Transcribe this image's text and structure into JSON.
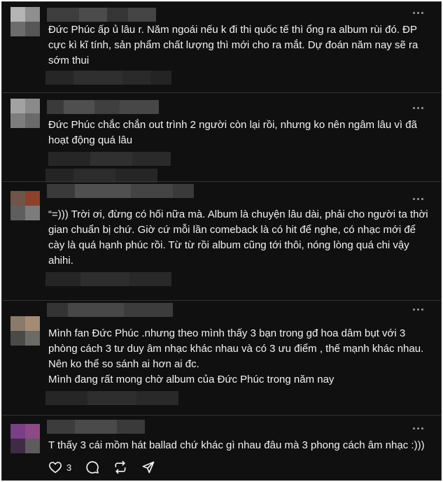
{
  "comments": [
    {
      "text": "Đức Phúc ấp ủ lâu r. Năm ngoái nếu k đi thi quốc tế thì ổng ra album rùi đó. ĐP cực kì kĩ tính, sản phẩm chất lượng thì mới cho ra mắt. Dự đoán năm nay sẽ ra sớm thui",
      "avatar_colors": [
        "#b4b4b4",
        "#8f8f8f",
        "#6c6c6c",
        "#565656"
      ]
    },
    {
      "text": "Đức Phúc chắc chắn out trình 2 người còn lại rồi, nhưng ko nên ngâm lâu vì đã hoạt động quá lâu",
      "avatar_colors": [
        "#a2a2a2",
        "#8a8a8a",
        "#7d7d7d",
        "#6a6a6a"
      ]
    },
    {
      "text": "“=))) Trời ơi, đừng có hối nữa mà. Album là chuyện lâu dài, phải cho người ta thời gian chuẩn bị chứ. Giờ cứ mỗi lần comeback là có hit để nghe, có nhạc mới để cày là quá hạnh phúc rồi. Từ từ rồi album cũng tới thôi, nóng lòng quá chi vậy ahihi.",
      "avatar_colors": [
        "#6f5547",
        "#8c4128",
        "#5e5e5e",
        "#7c7c7c"
      ]
    },
    {
      "text": "Mình fan Đức Phúc .nhưng theo mình thấy 3 bạn trong gđ hoa dâm bụt với 3 phòng cách 3 tư duy âm nhạc khác nhau và có 3 ưu điểm , thế mạnh khác nhau. Nên ko thể so sánh ai hơn ai đc.\nMình đang rất mong chờ album của Đức Phúc trong năm nay",
      "avatar_colors": [
        "#8a7a6a",
        "#a58b74",
        "#4a4a46",
        "#6a6a66"
      ]
    },
    {
      "text": "T thấy 3 cái mồm hát ballad chứ khác gì nhau đâu mà 3 phong cách âm nhạc :)))",
      "avatar_colors": [
        "#7a3f86",
        "#8d4a86",
        "#3e2c46",
        "#5c5c5c"
      ]
    }
  ],
  "actions": {
    "like_count": "3",
    "like_icon": "heart-icon",
    "reply_icon": "comment-icon",
    "repost_icon": "repost-icon",
    "share_icon": "send-icon"
  }
}
